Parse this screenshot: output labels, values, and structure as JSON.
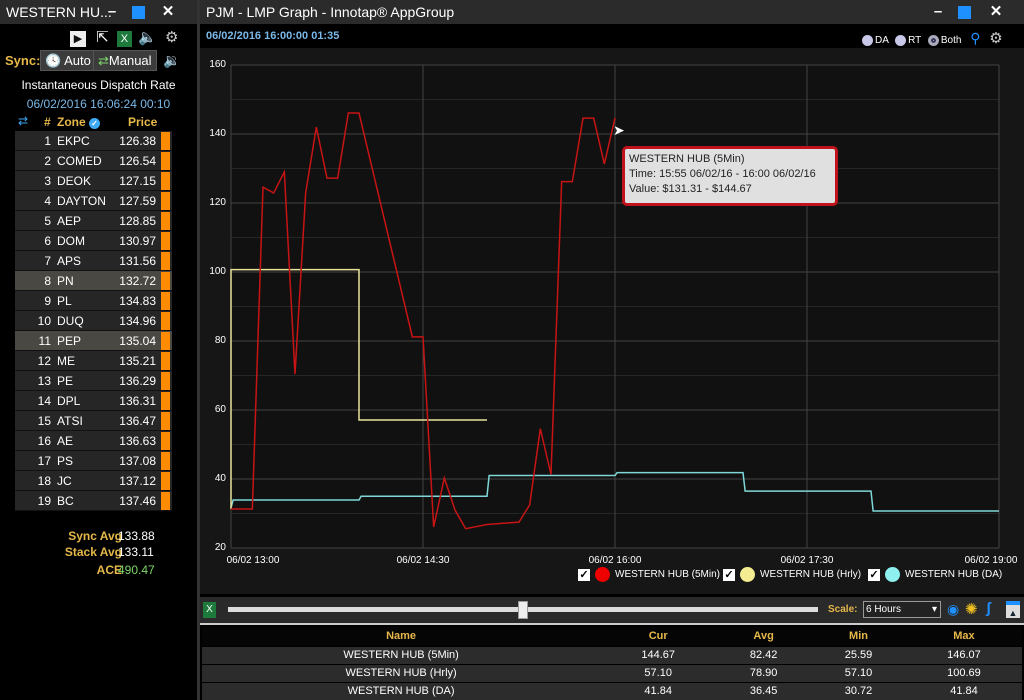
{
  "left_window": {
    "title": "WESTERN HU...",
    "sync_label": "Sync:",
    "auto_label": "Auto",
    "manual_label": "Manual",
    "heading": "Instantaneous Dispatch Rate",
    "timestamp": "06/02/2016 16:06:24  00:10",
    "col_num": "#",
    "col_zone": "Zone",
    "col_price": "Price",
    "zones": [
      {
        "n": "1",
        "zone": "EKPC",
        "price": "126.38"
      },
      {
        "n": "2",
        "zone": "COMED",
        "price": "126.54"
      },
      {
        "n": "3",
        "zone": "DEOK",
        "price": "127.15"
      },
      {
        "n": "4",
        "zone": "DAYTON",
        "price": "127.59"
      },
      {
        "n": "5",
        "zone": "AEP",
        "price": "128.85"
      },
      {
        "n": "6",
        "zone": "DOM",
        "price": "130.97"
      },
      {
        "n": "7",
        "zone": "APS",
        "price": "131.56"
      },
      {
        "n": "8",
        "zone": "PN",
        "price": "132.72",
        "highlight": true
      },
      {
        "n": "9",
        "zone": "PL",
        "price": "134.83"
      },
      {
        "n": "10",
        "zone": "DUQ",
        "price": "134.96"
      },
      {
        "n": "11",
        "zone": "PEP",
        "price": "135.04",
        "highlight": true
      },
      {
        "n": "12",
        "zone": "ME",
        "price": "135.21"
      },
      {
        "n": "13",
        "zone": "PE",
        "price": "136.29"
      },
      {
        "n": "14",
        "zone": "DPL",
        "price": "136.31"
      },
      {
        "n": "15",
        "zone": "ATSI",
        "price": "136.47"
      },
      {
        "n": "16",
        "zone": "AE",
        "price": "136.63"
      },
      {
        "n": "17",
        "zone": "PS",
        "price": "137.08"
      },
      {
        "n": "18",
        "zone": "JC",
        "price": "137.12"
      },
      {
        "n": "19",
        "zone": "BC",
        "price": "137.46"
      }
    ],
    "summary": {
      "sync_avg_label": "Sync Avg",
      "sync_avg": "133.88",
      "stack_avg_label": "Stack Avg",
      "stack_avg": "133.11",
      "ace_label": "ACE",
      "ace": "490.47"
    }
  },
  "main_window": {
    "title": "PJM - LMP Graph - Innotap® AppGroup",
    "timestamp": "06/02/2016 16:00:00  01:35",
    "radio": {
      "da": "DA",
      "rt": "RT",
      "both": "Both",
      "selected": "Both"
    },
    "tooltip": {
      "title": "WESTERN HUB (5Min)",
      "time": "Time: 15:55 06/02/16 - 16:00 06/02/16",
      "value": "Value: $131.31 - $144.67"
    },
    "scale_label": "Scale:",
    "scale_value": "6 Hours",
    "slider_position": 0.5,
    "table": {
      "headers": [
        "Name",
        "Cur",
        "Avg",
        "Min",
        "Max"
      ],
      "rows": [
        [
          "WESTERN HUB (5Min)",
          "144.67",
          "82.42",
          "25.59",
          "146.07"
        ],
        [
          "WESTERN HUB (Hrly)",
          "57.10",
          "78.90",
          "57.10",
          "100.69"
        ],
        [
          "WESTERN HUB (DA)",
          "41.84",
          "36.45",
          "30.72",
          "41.84"
        ]
      ]
    }
  },
  "chart_data": {
    "type": "line",
    "ylim": [
      20,
      160
    ],
    "yticks": [
      "160",
      "140",
      "120",
      "100",
      "80",
      "60",
      "40",
      "20"
    ],
    "xlim": [
      "13:00",
      "19:00"
    ],
    "xticks": [
      "06/02 13:00",
      "06/02 14:30",
      "06/02 16:00",
      "06/02 17:30",
      "06/02 19:00"
    ],
    "grid": true,
    "legend": "bottom-right",
    "series": [
      {
        "name": "WESTERN HUB (5Min)",
        "color": "#c81414",
        "points": [
          [
            "13:00",
            31.3
          ],
          [
            "13:10",
            31.3
          ],
          [
            "13:15",
            124.6
          ],
          [
            "13:20",
            122.9
          ],
          [
            "13:25",
            129.0
          ],
          [
            "13:30",
            70.4
          ],
          [
            "13:35",
            122.9
          ],
          [
            "13:40",
            142.0
          ],
          [
            "13:45",
            127.2
          ],
          [
            "13:50",
            127.2
          ],
          [
            "13:55",
            146.07
          ],
          [
            "14:00",
            146.07
          ],
          [
            "14:25",
            81.2
          ],
          [
            "14:30",
            81.2
          ],
          [
            "14:35",
            26.1
          ],
          [
            "14:40",
            40.3
          ],
          [
            "14:45",
            31.0
          ],
          [
            "14:50",
            25.59
          ],
          [
            "15:00",
            26.8
          ],
          [
            "15:10",
            27.3
          ],
          [
            "15:15",
            27.5
          ],
          [
            "15:20",
            32.5
          ],
          [
            "15:25",
            54.6
          ],
          [
            "15:30",
            41.3
          ],
          [
            "15:35",
            126.2
          ],
          [
            "15:40",
            126.2
          ],
          [
            "15:45",
            144.6
          ],
          [
            "15:50",
            144.6
          ],
          [
            "15:55",
            131.31
          ],
          [
            "16:00",
            144.67
          ]
        ]
      },
      {
        "name": "WESTERN HUB (Hrly)",
        "color": "#e8e49a",
        "points": [
          [
            "13:00",
            31.3
          ],
          [
            "13:00",
            100.69
          ],
          [
            "14:00",
            100.69
          ],
          [
            "14:00",
            57.1
          ],
          [
            "15:00",
            57.1
          ]
        ]
      },
      {
        "name": "WESTERN HUB (DA)",
        "color": "#7fd8d8",
        "points": [
          [
            "13:00",
            31.6
          ],
          [
            "13:01",
            33.9
          ],
          [
            "14:00",
            33.9
          ],
          [
            "14:01",
            35.0
          ],
          [
            "15:00",
            35.0
          ],
          [
            "15:01",
            41.0
          ],
          [
            "16:00",
            41.0
          ],
          [
            "16:01",
            41.84
          ],
          [
            "17:00",
            41.84
          ],
          [
            "17:01",
            36.5
          ],
          [
            "18:00",
            36.5
          ],
          [
            "18:01",
            30.72
          ],
          [
            "19:00",
            30.72
          ]
        ]
      }
    ]
  }
}
